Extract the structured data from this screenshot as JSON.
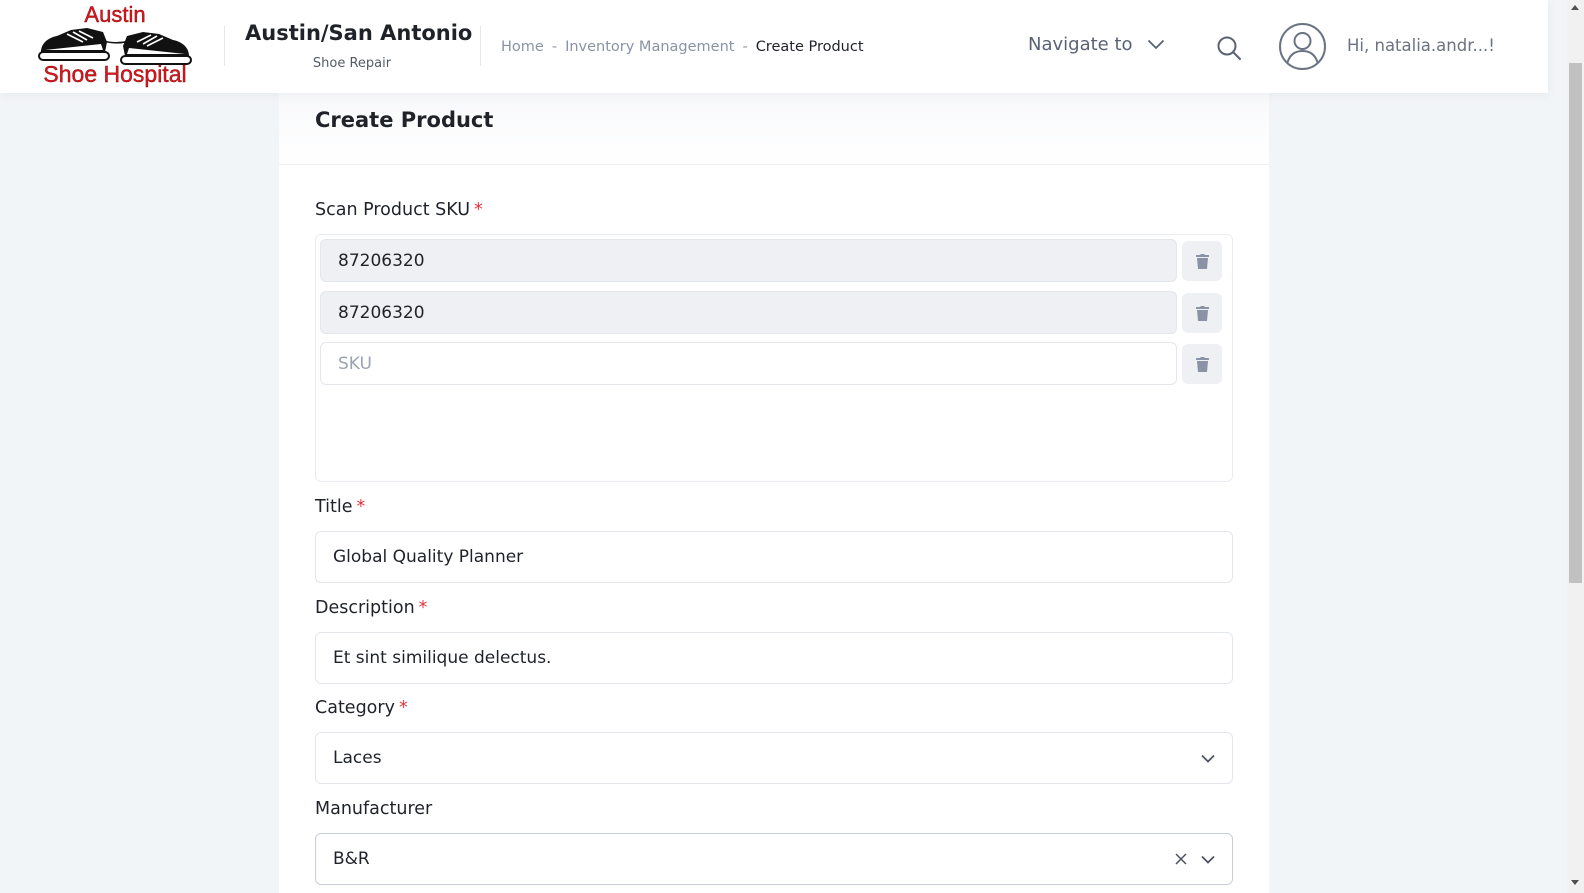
{
  "header": {
    "logo_line1": "Austin",
    "logo_line2": "Shoe Hospital",
    "store_name": "Austin/San Antonio",
    "store_subtitle": "Shoe Repair",
    "breadcrumb": {
      "home": "Home",
      "separator": "-",
      "section": "Inventory Management",
      "current": "Create Product"
    },
    "navigate_label": "Navigate to",
    "greeting": "Hi, natalia.andr...!"
  },
  "form": {
    "title": "Create Product",
    "required_mark": "*",
    "sku": {
      "label": "Scan Product SKU",
      "rows": [
        {
          "value": "87206320"
        },
        {
          "value": "87206320"
        }
      ],
      "empty_placeholder": "SKU"
    },
    "title_field": {
      "label": "Title",
      "value": "Global Quality Planner"
    },
    "description": {
      "label": "Description",
      "value": "Et sint similique delectus."
    },
    "category": {
      "label": "Category",
      "value": "Laces"
    },
    "manufacturer": {
      "label": "Manufacturer",
      "value": "B&R"
    }
  },
  "icons": {
    "navigate_chevron": "chevron-down-icon",
    "search": "search-icon",
    "avatar": "user-avatar-icon",
    "trash": "trash-icon",
    "clear": "close-icon"
  },
  "colors": {
    "required": "#e5323c",
    "logo_red": "#e0141b",
    "breadcrumb_link": "#8a93a6"
  }
}
